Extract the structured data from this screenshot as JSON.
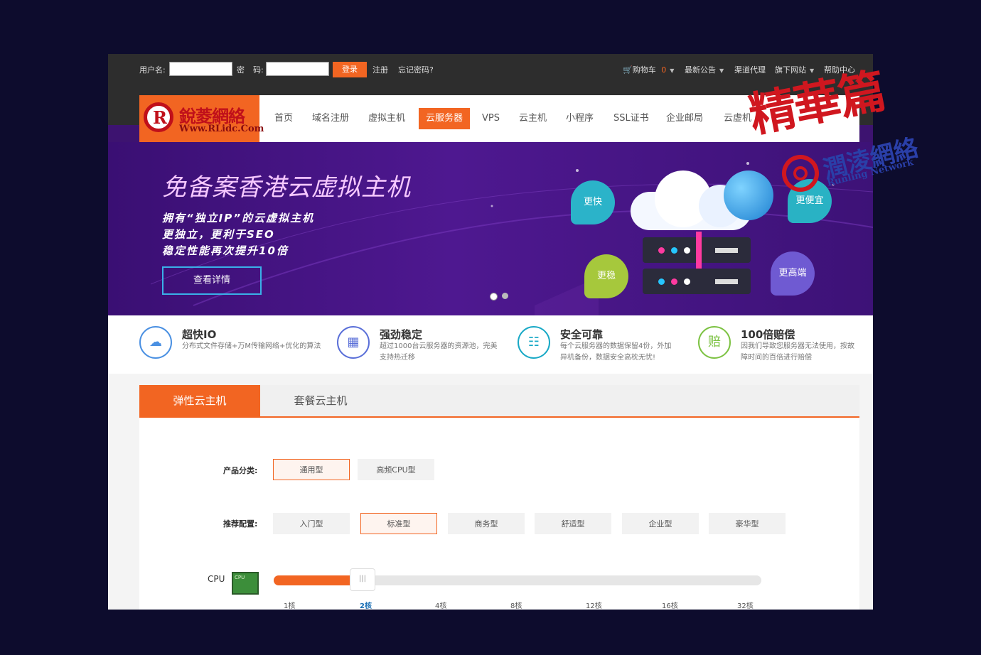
{
  "topbar": {
    "username_label": "用户名:",
    "password_label_1": "密",
    "password_label_2": "码:",
    "login_button": "登录",
    "register_link": "注册",
    "forgot_link": "忘记密码?",
    "cart_label": "购物车",
    "cart_count": "0",
    "links": [
      "最新公告",
      "渠道代理",
      "旗下网站",
      "帮助中心"
    ]
  },
  "logo": {
    "name": "銳菱網絡",
    "url": "Www.RLidc.Com"
  },
  "nav": {
    "items": [
      "首页",
      "域名注册",
      "虚拟主机",
      "云服务器",
      "VPS",
      "云主机",
      "小程序",
      "SSL证书",
      "企业邮局",
      "云虚机"
    ],
    "active_index": 3
  },
  "banner": {
    "title": "免备案香港云虚拟主机",
    "lines": [
      "拥有“独立IP”的云虚拟主机",
      "更独立，更利于SEO",
      "稳定性能再次提升10倍"
    ],
    "button": "查看详情",
    "bubbles": [
      "更快",
      "更便宜",
      "更稳",
      "更高端"
    ]
  },
  "features": [
    {
      "title": "超快IO",
      "desc": "分布式文件存储+万M传输网络+优化的算法",
      "icon": "cloud-lightning-icon",
      "color": "#4a90e2"
    },
    {
      "title": "强劲稳定",
      "desc": "超过1000台云服务器的资源池，完美支持热迁移",
      "icon": "server-cluster-icon",
      "color": "#5a6fd8"
    },
    {
      "title": "安全可靠",
      "desc": "每个云服务器的数据保留4份，外加异机备份，数据安全高枕无忧!",
      "icon": "network-tree-icon",
      "color": "#19a9c6"
    },
    {
      "title": "100倍赔偿",
      "desc": "因我们导致您服务器无法使用，按故障时间的百倍进行赔偿",
      "icon": "compensation-icon",
      "color": "#7cc242"
    }
  ],
  "tabs": [
    "弹性云主机",
    "套餐云主机"
  ],
  "panel": {
    "category_label": "产品分类:",
    "categories": [
      "通用型",
      "高频CPU型"
    ],
    "category_selected": 0,
    "config_label": "推荐配置:",
    "configs": [
      "入门型",
      "标准型",
      "商务型",
      "舒适型",
      "企业型",
      "豪华型"
    ],
    "config_selected": 1,
    "cpu_label": "CPU",
    "cpu_chip_text": "CPU",
    "cpu_handle": "|||",
    "cpu_ticks": [
      "1核",
      "2核",
      "4核",
      "8核",
      "12核",
      "16核",
      "32核"
    ],
    "cpu_selected": 1,
    "cpu_fraction": 0.167
  },
  "watermark": {
    "title": "精華篇",
    "brand": "潤淩網絡",
    "brand_en": "Runling Network"
  },
  "colors": {
    "accent": "#f26522",
    "banner_purple": "#4e1890",
    "page_bg": "#0d0c2d"
  }
}
